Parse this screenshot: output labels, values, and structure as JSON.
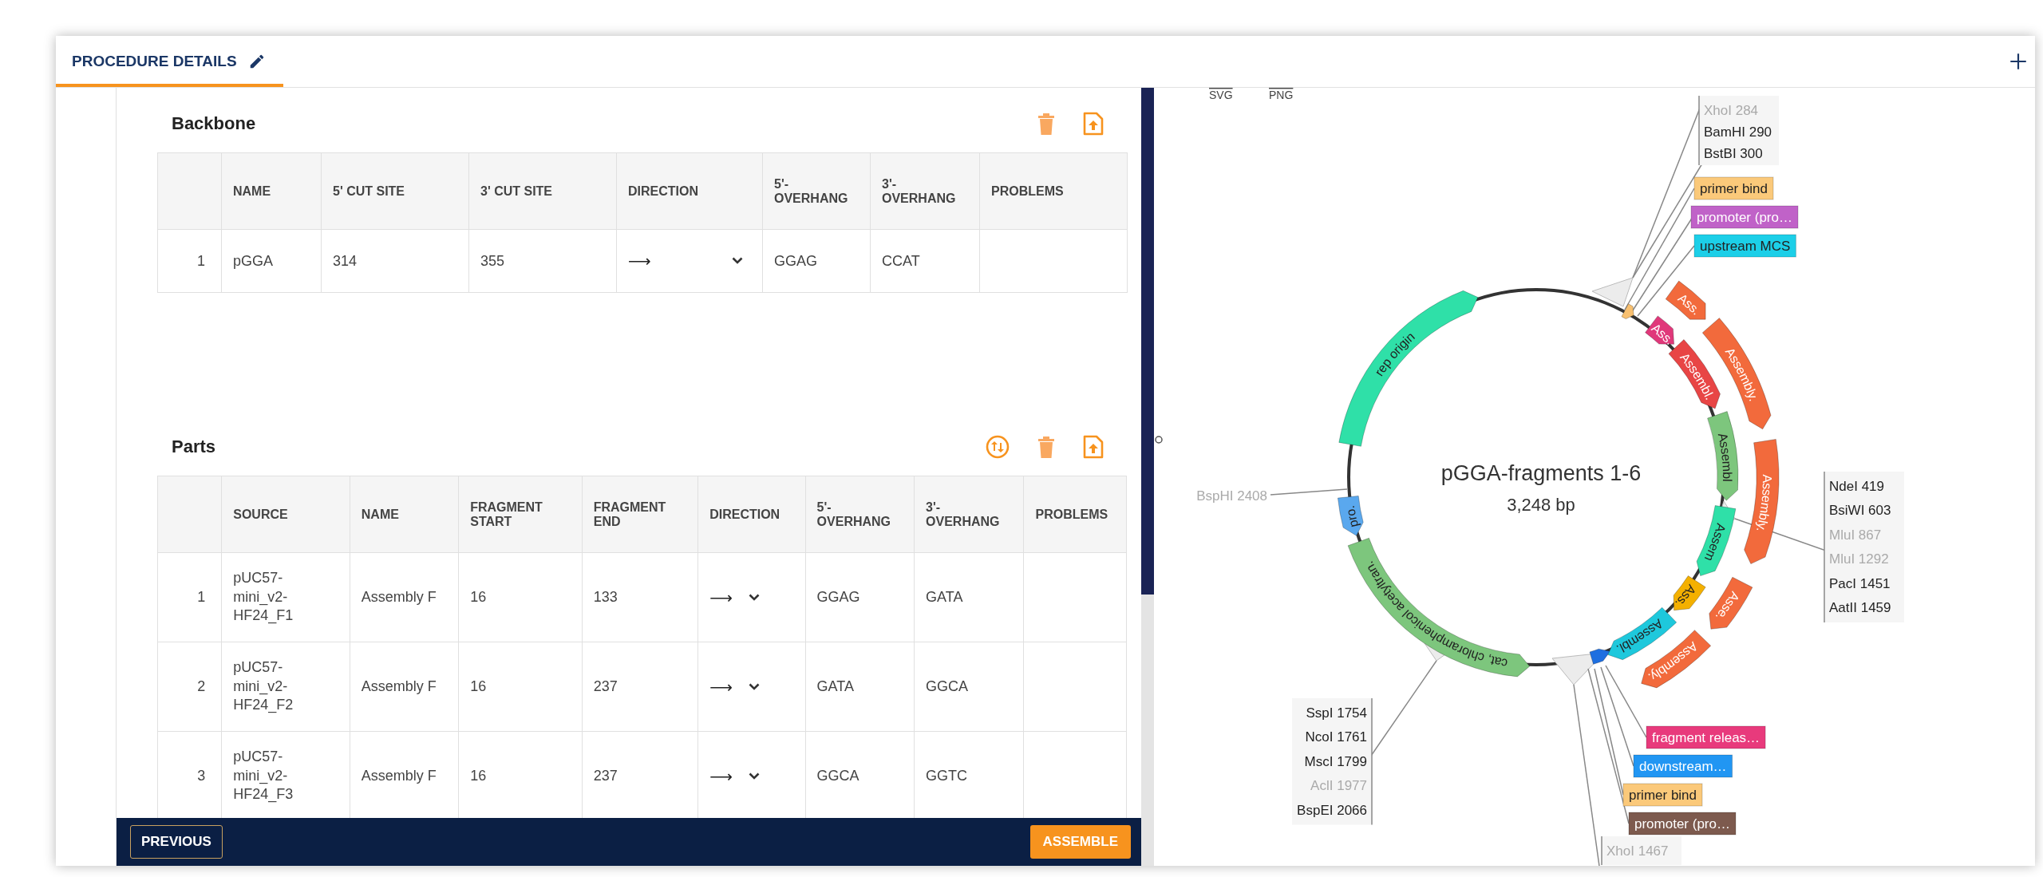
{
  "tab": {
    "label": "PROCEDURE DETAILS",
    "selected": true
  },
  "sections": [
    {
      "title": "Backbone",
      "columns": [
        {
          "label": "NAME",
          "kind": "text"
        },
        {
          "label": "5' CUT SITE",
          "kind": "text"
        },
        {
          "label": "3' CUT SITE",
          "kind": "text"
        },
        {
          "label": "DIRECTION",
          "kind": "direction"
        },
        {
          "label": "5'-OVERHANG",
          "kind": "text"
        },
        {
          "label": "3'-OVERHANG",
          "kind": "text"
        },
        {
          "label": "PROBLEMS",
          "kind": "text"
        }
      ],
      "rows": [
        {
          "index": "1",
          "cells": [
            "pGGA",
            "314",
            "355",
            "⟶",
            "GGAG",
            "CCAT"
          ]
        }
      ]
    },
    {
      "title": "Parts",
      "columns": [
        {
          "label": "SOURCE",
          "kind": "source"
        },
        {
          "label": "NAME",
          "kind": "text"
        },
        {
          "label": "FRAGMENT START",
          "kind": "text"
        },
        {
          "label": "FRAGMENT END",
          "kind": "text"
        },
        {
          "label": "DIRECTION",
          "kind": "direction"
        },
        {
          "label": "5'-OVERHANG",
          "kind": "text"
        },
        {
          "label": "3'-OVERHANG",
          "kind": "text"
        },
        {
          "label": "PROBLEMS",
          "kind": "text"
        }
      ],
      "rows": [
        {
          "index": "1",
          "cells": [
            "pUC57-mini_v2-HF24_F1",
            "Assembly F",
            "16",
            "133",
            "⟶",
            "GGAG",
            "GATA"
          ]
        },
        {
          "index": "2",
          "cells": [
            "pUC57-mini_v2-HF24_F2",
            "Assembly F",
            "16",
            "237",
            "⟶",
            "GATA",
            "GGCA"
          ]
        },
        {
          "index": "3",
          "cells": [
            "pUC57-mini_v2-HF24_F3",
            "Assembly F",
            "16",
            "237",
            "⟶",
            "GGCA",
            "GGTC"
          ]
        }
      ]
    }
  ],
  "footer": [
    {
      "label": "PREVIOUS",
      "kind": "secondary"
    },
    {
      "label": "ASSEMBLE",
      "kind": "primary"
    }
  ],
  "map": {
    "export": [
      "SVG",
      "PNG"
    ],
    "title": "pGGA-fragments 1-6",
    "length": "3,248 bp",
    "features": [
      {
        "label": "rep origin",
        "color": "#2fe0a8",
        "reverse": false
      },
      {
        "label": "pro.",
        "color": "#5aa8ee",
        "reverse": true
      },
      {
        "label": "cat, chloramphenicol acetyltran.",
        "color": "#7dc67d",
        "reverse": true
      },
      {
        "color": "#1e6fe0",
        "reverse": true
      },
      {
        "color": "#f8c070",
        "reverse": false
      },
      {
        "label": "Ass.",
        "color": "#e0387a",
        "reverse": false
      },
      {
        "label": "Assembl.",
        "color": "#e84545",
        "reverse": false
      },
      {
        "label": "Assembl",
        "color": "#7dc67d",
        "reverse": false
      },
      {
        "label": "Assem",
        "color": "#2fe0a8",
        "reverse": false
      },
      {
        "label": "Ass.",
        "color": "#f4b000",
        "reverse": false
      },
      {
        "label": "Assembl.",
        "color": "#1ec8dc",
        "reverse": false
      },
      {
        "label": "Ass.",
        "color": "#f26a3c",
        "reverse": false
      },
      {
        "label": "Assembly.",
        "color": "#f26a3c",
        "reverse": false
      },
      {
        "label": "Assembly.",
        "color": "#f26a3c",
        "reverse": false
      },
      {
        "label": "Asse.",
        "color": "#f26a3c",
        "reverse": false
      },
      {
        "label": "Assembly.",
        "color": "#f26a3c",
        "reverse": false
      }
    ],
    "cut_site_groups": [
      {
        "sites": [
          {
            "label": "XhoI 284",
            "dimmed": true
          },
          {
            "label": "BamHI 290",
            "dimmed": false
          },
          {
            "label": "BstBI 300",
            "dimmed": false
          }
        ]
      },
      {
        "sites": [
          {
            "label": "NdeI 419",
            "dimmed": false
          },
          {
            "label": "BsiWI 603",
            "dimmed": false
          },
          {
            "label": "MluI 867",
            "dimmed": true
          },
          {
            "label": "MluI 1292",
            "dimmed": true
          },
          {
            "label": "PacI 1451",
            "dimmed": false
          },
          {
            "label": "AatII 1459",
            "dimmed": false
          }
        ]
      },
      {
        "sites": [
          {
            "label": "SspI 1754",
            "dimmed": false
          },
          {
            "label": "NcoI 1761",
            "dimmed": false
          },
          {
            "label": "MscI 1799",
            "dimmed": false
          },
          {
            "label": "AclI 1977",
            "dimmed": true
          },
          {
            "label": "BspEI 2066",
            "dimmed": false
          }
        ]
      },
      {
        "sites": [
          {
            "label": "BspHI 2408",
            "dimmed": true
          }
        ]
      },
      {
        "sites": [
          {
            "label": "XhoI 1467",
            "dimmed": true
          }
        ]
      }
    ],
    "tags": [
      {
        "label": "primer bind",
        "color": "#fbc97a"
      },
      {
        "label": "promoter (pro…",
        "color": "#c062c8"
      },
      {
        "label": "upstream MCS",
        "color": "#1ccfe8"
      },
      {
        "label": "fragment releas…",
        "color": "#e83a7c"
      },
      {
        "label": "downstream…",
        "color": "#2196f3"
      },
      {
        "label": "primer bind",
        "color": "#fbc97a"
      },
      {
        "label": "promoter (pro…",
        "color": "#7d5a4e"
      }
    ]
  }
}
